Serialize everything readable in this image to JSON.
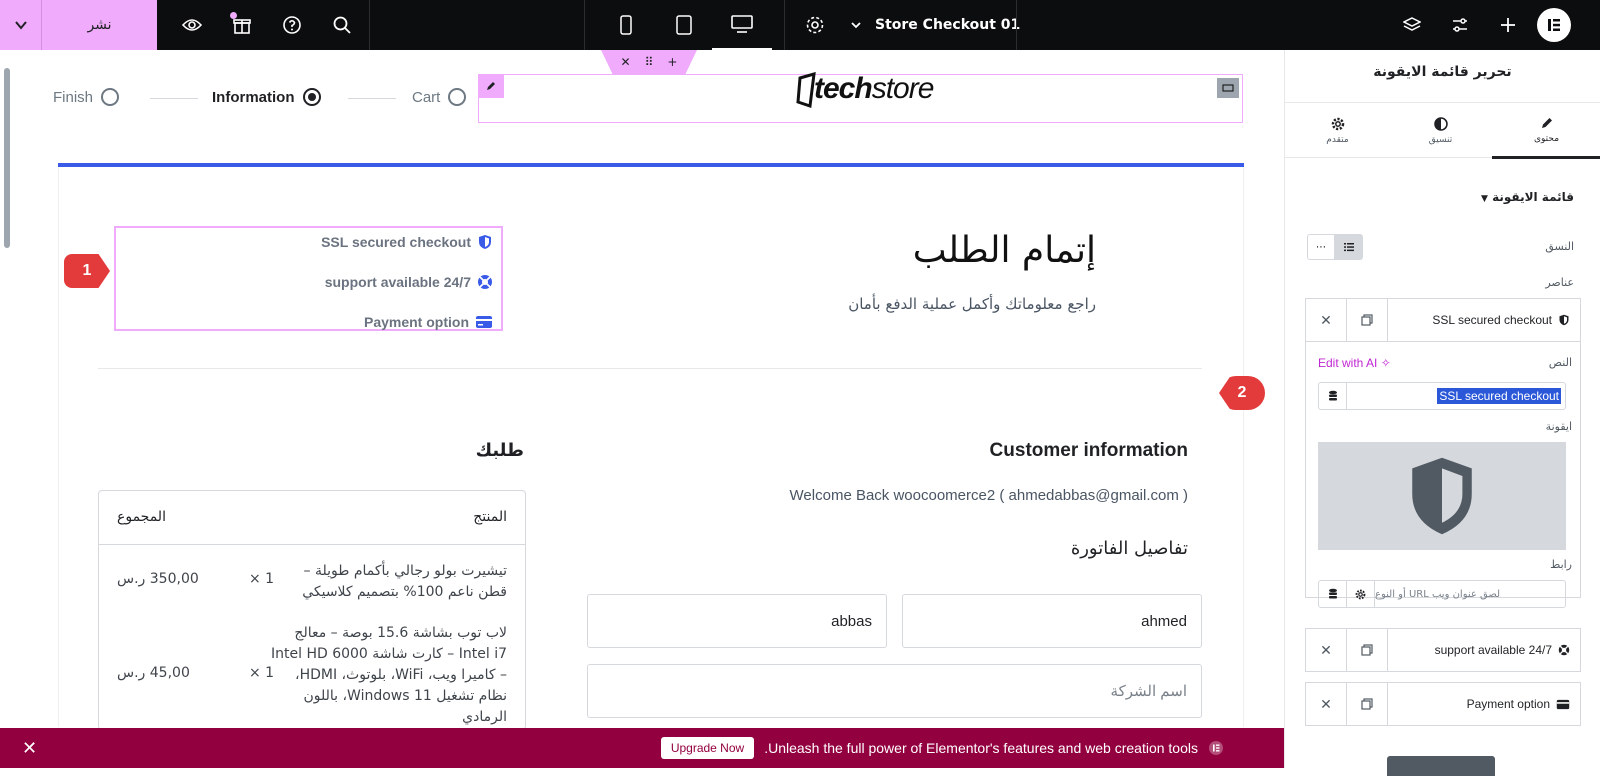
{
  "topbar": {
    "publish_label": "نشر",
    "document_title": "Store Checkout 01"
  },
  "canvas": {
    "steps": [
      {
        "label": "Finish",
        "state": "inactive"
      },
      {
        "label": "Information",
        "state": "active"
      },
      {
        "label": "Cart",
        "state": "inactive"
      }
    ],
    "logo_text": {
      "tech": "tech",
      "store": "store"
    },
    "heading": "إتمام الطلب",
    "subheading": "راجع معلوماتك وأكمل عملية الدفع بأمان",
    "icon_list": [
      {
        "text": "SSL secured checkout",
        "icon": "shield-icon"
      },
      {
        "text": "support available 24/7",
        "icon": "lifebuoy-icon"
      },
      {
        "text": "Payment option",
        "icon": "credit-card-icon"
      }
    ],
    "markers": [
      "1",
      "2"
    ],
    "customer": {
      "title": "Customer information",
      "welcome": "Welcome Back woocoomerce2 ( ahmedabbas@gmail.com )",
      "billing_title": "تفاصيل الفاتورة",
      "first_name": "ahmed",
      "last_name": "abbas",
      "company_placeholder": "اسم الشركة"
    },
    "order": {
      "title": "طلبك",
      "col_product": "المنتج",
      "col_total": "المجموع",
      "items": [
        {
          "name_line1": "تيشيرت بولو رجالي بأكمام طويلة –",
          "name_line2": "قطن ناعم 100% بتصميم كلاسيكي",
          "qty": "× 1",
          "total": "350,00 ر.س"
        },
        {
          "name_line1": "لاب توب بشاشة 15.6 بوصة – معالج",
          "name_line2": "Intel i7 – كارت شاشة Intel HD 6000",
          "name_line3": "– كاميرا ويب، WiFi، بلوتوث، HDMI،",
          "name_line4": "نظام تشغيل Windows 11، باللون",
          "name_line5": "الرمادي",
          "qty": "× 1",
          "total": "45,00 ر.س"
        }
      ]
    }
  },
  "promo": {
    "text": ".Unleash the full power of Elementor's features and web creation tools",
    "button": "Upgrade Now"
  },
  "panel": {
    "title": "تحرير قائمة الايقونة",
    "tabs": [
      {
        "label": "محتوى",
        "icon": "pencil-icon"
      },
      {
        "label": "تنسيق",
        "icon": "contrast-icon"
      },
      {
        "label": "متقدم",
        "icon": "gear-icon"
      }
    ],
    "section": "قائمة الايقونة",
    "layout_label": "النسق",
    "items_label": "عناصر",
    "text_label": "النص",
    "edit_ai": "Edit with AI",
    "text_value": "SSL secured checkout",
    "icon_label": "ايقونة",
    "link_label": "رابط",
    "link_placeholder": "لصق عنوان ويب URL أو النوع",
    "repeater_items": [
      "SSL secured checkout",
      "support available 24/7",
      "Payment option"
    ]
  },
  "colors": {
    "accent": "#f0abfc",
    "topbar": "#0c0d0e",
    "promo": "#93003f",
    "rule_blue": "#3a5be8",
    "marker_red": "#e33b3b"
  }
}
